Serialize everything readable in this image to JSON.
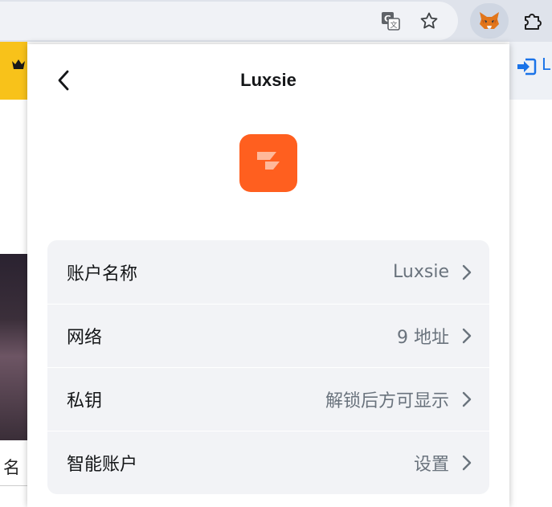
{
  "browser": {
    "icons": [
      "translate-icon",
      "star-icon",
      "metamask-fox-icon",
      "puzzle-icon"
    ]
  },
  "background_page": {
    "name_fragment": "名",
    "login_fragment": "L",
    "colors": {
      "banner": "#f8c21a",
      "link": "#1a73e8"
    }
  },
  "popup": {
    "title": "Luxsie",
    "back_icon": "chevron-left-icon",
    "avatar_color": "#ff5f1f",
    "rows": [
      {
        "label": "账户名称",
        "value": "Luxsie"
      },
      {
        "label": "网络",
        "value": "9 地址"
      },
      {
        "label": "私钥",
        "value": "解锁后方可显示"
      },
      {
        "label": "智能账户",
        "value": "设置"
      }
    ]
  }
}
